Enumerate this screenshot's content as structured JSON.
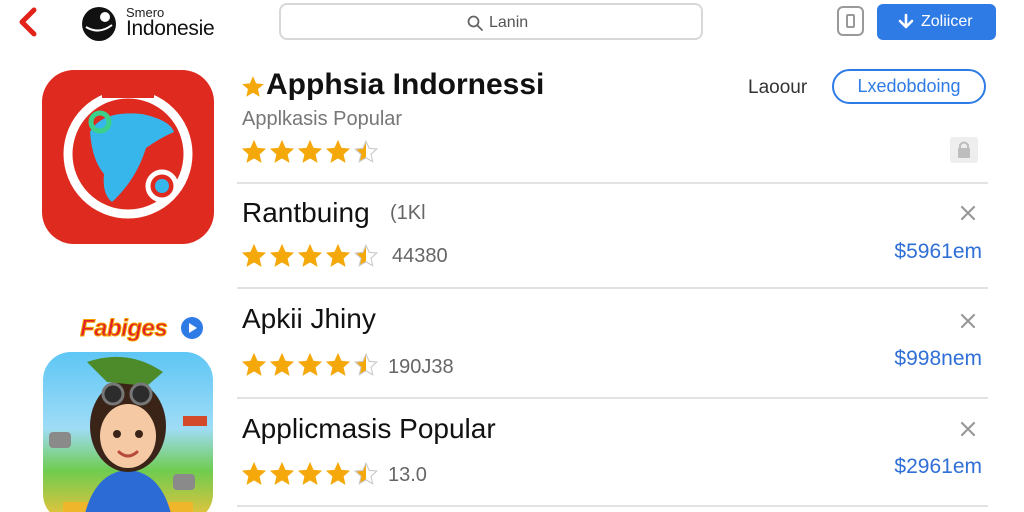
{
  "header": {
    "brand_small": "Smero",
    "brand_name": "Indonesie",
    "search_placeholder": "Lanin",
    "download_label": "Zoliicer"
  },
  "featured": {
    "title": "Apphsia Indornessi",
    "subtitle": "Applkasis Popular",
    "rating": 4.5,
    "link_label": "Laoour",
    "button_label": "Lxedobdoing"
  },
  "promo": {
    "label": "Fabiges"
  },
  "rows": [
    {
      "title": "Rantbuing",
      "tag": "(1Kl",
      "rating": 4.5,
      "count": "44380",
      "price": "$5961em"
    },
    {
      "title": "Apkii Jhiny",
      "tag": "",
      "rating": 4.5,
      "count": "190J38",
      "price": "$998nem"
    },
    {
      "title": "Applicmasis Popular",
      "tag": "",
      "rating": 4.5,
      "count": "13.0",
      "price": "$2961em"
    }
  ],
  "colors": {
    "accent": "#2f7be6",
    "star": "#f5a80a",
    "icon_red": "#de2a1f",
    "back_arrow": "#e2231a"
  },
  "icons": [
    "back-arrow-icon",
    "brand-logo-icon",
    "search-icon",
    "phone-icon",
    "download-icon",
    "star-icon",
    "lock-icon",
    "close-icon",
    "play-icon"
  ]
}
